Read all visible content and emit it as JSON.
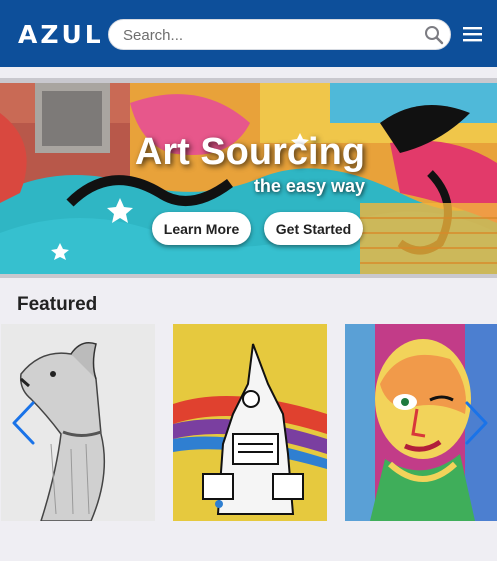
{
  "header": {
    "logo": "AZUL",
    "search": {
      "placeholder": "Search..."
    },
    "icons": [
      "search-icon",
      "hamburger-menu-icon"
    ]
  },
  "hero": {
    "title": "Art Sourcing",
    "subtitle": "the easy way",
    "buttons": {
      "learn_more": "Learn More",
      "get_started": "Get Started"
    }
  },
  "featured": {
    "title": "Featured",
    "items": [
      {
        "description": "pencil sketch of a dog"
      },
      {
        "description": "colorful graffiti illustration"
      },
      {
        "description": "painted portrait of a woman"
      }
    ],
    "icons": [
      "chevron-left-icon",
      "chevron-right-icon"
    ]
  },
  "colors": {
    "header": "#0d4f9a",
    "background": "#efeef3",
    "arrow": "#1a73e8"
  }
}
